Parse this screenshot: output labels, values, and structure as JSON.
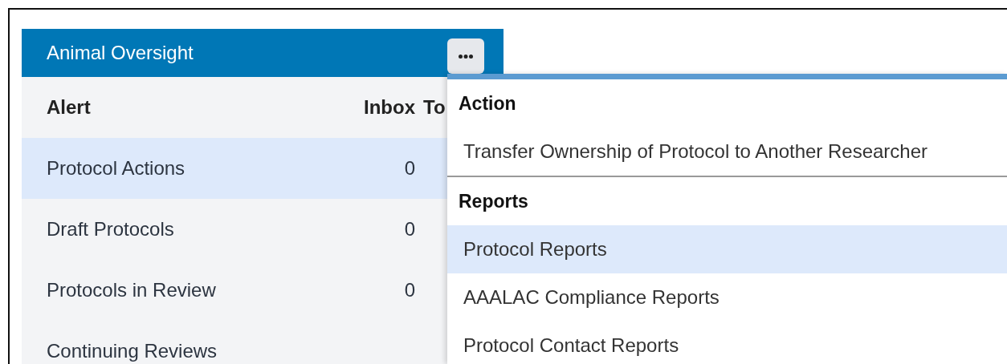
{
  "panel": {
    "title": "Animal Oversight",
    "columns": [
      "Alert",
      "Inbox",
      "To"
    ],
    "rows": [
      {
        "alert": "Protocol Actions",
        "inbox": "0",
        "selected": true
      },
      {
        "alert": "Draft Protocols",
        "inbox": "0",
        "selected": false
      },
      {
        "alert": "Protocols in Review",
        "inbox": "0",
        "selected": false
      },
      {
        "alert": "Continuing Reviews",
        "selected": false
      }
    ]
  },
  "menu": {
    "sections": [
      {
        "heading": "Action",
        "items": [
          {
            "label": "Transfer Ownership of Protocol to Another Researcher",
            "selected": false
          }
        ]
      },
      {
        "heading": "Reports",
        "items": [
          {
            "label": "Protocol Reports",
            "selected": true
          },
          {
            "label": "AAALAC Compliance Reports",
            "selected": false
          },
          {
            "label": "Protocol Contact Reports",
            "selected": false
          }
        ]
      }
    ]
  }
}
